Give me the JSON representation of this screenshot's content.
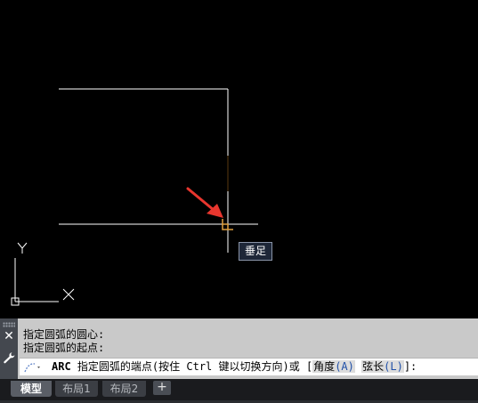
{
  "drawing": {
    "ucs_x_label": "X",
    "ucs_y_label": "Y",
    "tooltip": "垂足",
    "colors": {
      "background": "#000000",
      "geometry": "#ffffff",
      "crosshair": "#ffffff",
      "snap_marker": "#e0a040",
      "arrow": "#e8362e"
    }
  },
  "command": {
    "history": [
      "指定圆弧的圆心:",
      "指定圆弧的起点:"
    ],
    "prompt": {
      "command": "ARC",
      "text": "指定圆弧的端点(按住 Ctrl 键以切换方向)或 [",
      "option1_label": "角度",
      "option1_key": "(A)",
      "option2_label": "弦长",
      "option2_key": "(L)",
      "suffix": "]:"
    },
    "close_icon": "close-icon",
    "settings_icon": "wrench-icon"
  },
  "tabs": {
    "items": [
      "模型",
      "布局1",
      "布局2"
    ],
    "active": "模型",
    "add_label": "+"
  }
}
